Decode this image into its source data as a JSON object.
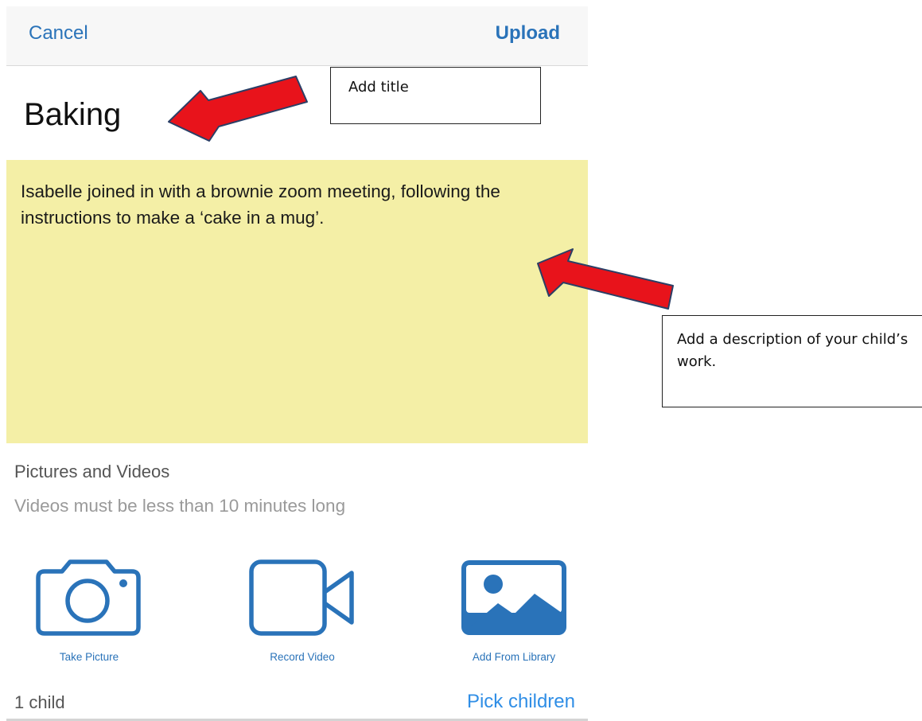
{
  "navbar": {
    "cancel_label": "Cancel",
    "upload_label": "Upload"
  },
  "post": {
    "title": "Baking",
    "description": "Isabelle joined in with a brownie zoom meeting, following the instructions to make a ‘cake in a mug’."
  },
  "media": {
    "section_title": "Pictures and Videos",
    "section_note": "Videos must be less than 10 minutes long",
    "buttons": [
      {
        "label": "Take Picture",
        "icon": "camera-icon"
      },
      {
        "label": "Record Video",
        "icon": "video-camera-icon"
      },
      {
        "label": "Add From Library",
        "icon": "photo-library-icon"
      }
    ]
  },
  "children": {
    "count_label": "1 child",
    "pick_label": "Pick children"
  },
  "annotations": {
    "title_callout": "Add title",
    "description_callout": "Add a description of your child’s work."
  },
  "colors": {
    "accent": "#2a73b9",
    "description_bg": "#f4efa6",
    "arrow": "#e8131b"
  }
}
